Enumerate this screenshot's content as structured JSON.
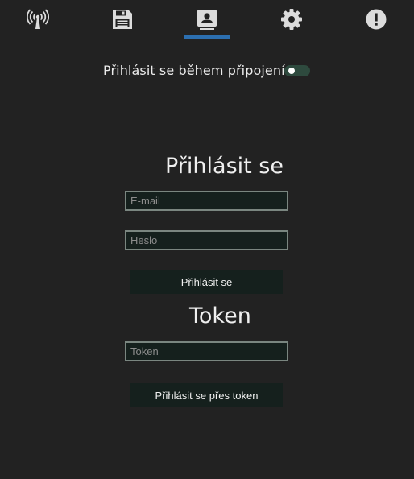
{
  "tabs": [
    {
      "icon": "broadcast-icon",
      "active": false
    },
    {
      "icon": "save-icon",
      "active": false
    },
    {
      "icon": "account-box-icon",
      "active": true
    },
    {
      "icon": "gear-icon",
      "active": false
    },
    {
      "icon": "alert-icon",
      "active": false
    }
  ],
  "colors": {
    "background": "#222222",
    "accent": "#2c6fb0",
    "field_bg": "#15201d",
    "toggle_track": "#2e4a3e"
  },
  "autologin": {
    "label": "Přihlásit se během připojení",
    "enabled": false
  },
  "login": {
    "title": "Přihlásit se",
    "email_placeholder": "E-mail",
    "password_placeholder": "Heslo",
    "button_label": "Přihlásit se"
  },
  "token": {
    "title": "Token",
    "placeholder": "Token",
    "button_label": "Přihlásit se přes token"
  }
}
